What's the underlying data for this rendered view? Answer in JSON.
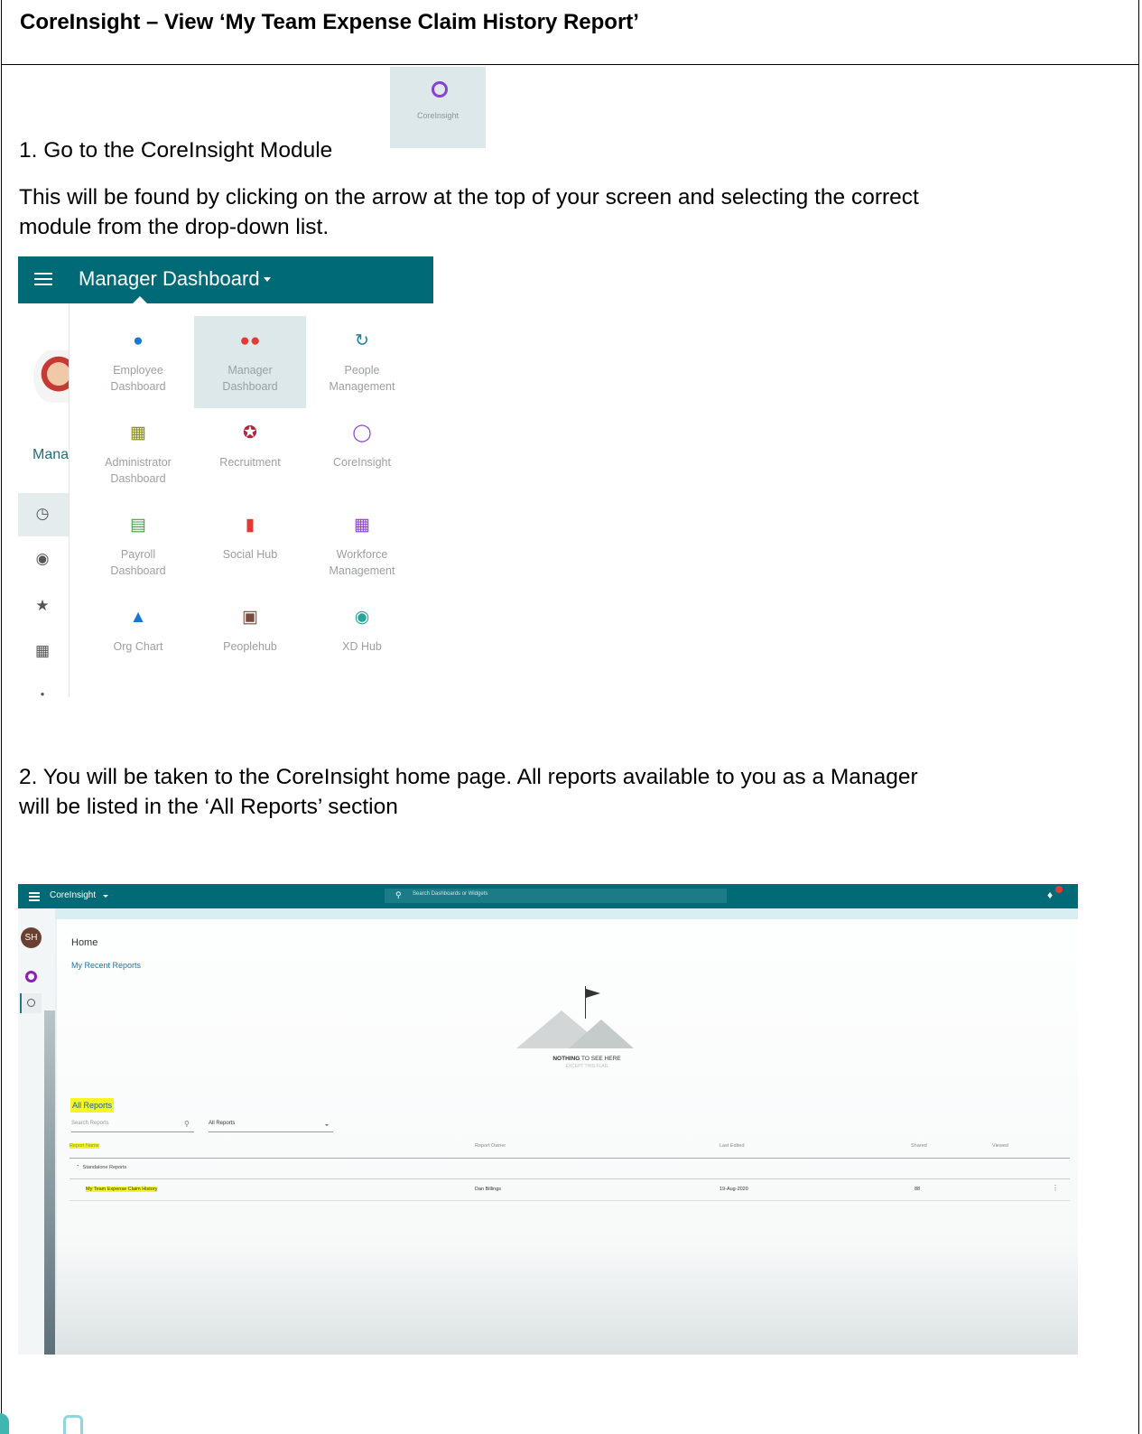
{
  "document": {
    "title": "CoreInsight – View ‘My Team Expense Claim History Report’",
    "step1": "1. Go to the CoreInsight Module",
    "step1_detail_line1": "This will be found by clicking on the arrow at the top of your screen and selecting the correct",
    "step1_detail_line2": "module from the drop-down list.",
    "step2_line1": "2. You will be taken to the CoreInsight home page.  All reports available to you as a Manager",
    "step2_line2": "will be listed in the ‘All Reports’ section"
  },
  "module_tile": {
    "label": "CoreInsight",
    "icon": "ring-icon",
    "color": "#8a3fd1"
  },
  "menu_screenshot": {
    "header_title": "Manager Dashboard",
    "left_partial_label": "Mana",
    "accent": "#006b77",
    "items": [
      {
        "line1": "Employee",
        "line2": "Dashboard",
        "icon": "person-icon",
        "color": "#1976d2"
      },
      {
        "line1": "Manager",
        "line2": "Dashboard",
        "icon": "people-icon",
        "color": "#e53935"
      },
      {
        "line1": "People",
        "line2": "Management",
        "icon": "search-refresh-icon",
        "color": "#1a7fa8"
      },
      {
        "line1": "Administrator",
        "line2": "Dashboard",
        "icon": "dashboard-icon",
        "color": "#8a8a14"
      },
      {
        "line1": "Recruitment",
        "line2": "",
        "icon": "star-badge-icon",
        "color": "#b0273b"
      },
      {
        "line1": "CoreInsight",
        "line2": "",
        "icon": "ring-icon",
        "color": "#8a3fd1"
      },
      {
        "line1": "Payroll",
        "line2": "Dashboard",
        "icon": "card-icon",
        "color": "#43a047"
      },
      {
        "line1": "Social Hub",
        "line2": "",
        "icon": "chat-icon",
        "color": "#e53935"
      },
      {
        "line1": "Workforce",
        "line2": "Management",
        "icon": "calendar-icon",
        "color": "#8a3fd1"
      },
      {
        "line1": "Org Chart",
        "line2": "",
        "icon": "org-chart-icon",
        "color": "#1976d2"
      },
      {
        "line1": "Peoplehub",
        "line2": "",
        "icon": "person-board-icon",
        "color": "#7a4a3a"
      },
      {
        "line1": "XD Hub",
        "line2": "",
        "icon": "globe-icon",
        "color": "#26a69a"
      }
    ]
  },
  "home_screenshot": {
    "app_title": "CoreInsight",
    "search_placeholder": "Search Dashboards or Widgets",
    "avatar_initials": "SH",
    "page_title": "Home",
    "recent_link": "My Recent Reports",
    "empty_state_bold": "NOTHING",
    "empty_state_rest": " TO SEE HERE",
    "empty_state_sub": "EXCEPT THIS FLAG",
    "all_reports": "All Reports",
    "search_reports_placeholder": "Search Reports",
    "filter_value": "All Reports",
    "columns": [
      "Report Name",
      "Report Owner",
      "Last Edited",
      "Shared",
      "Viewed"
    ],
    "group": "Standalone Reports",
    "row": {
      "name": "My Team Expense Claim History",
      "owner": "Dan Billings",
      "last_edited": "19-Aug-2020",
      "shared": "88"
    },
    "highlight": "#f5f525"
  }
}
